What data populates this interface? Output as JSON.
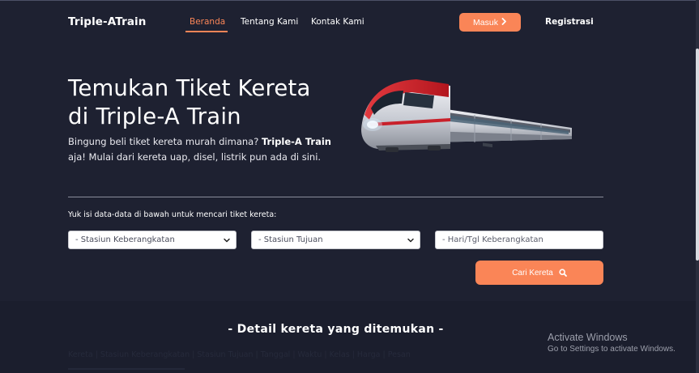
{
  "navbar": {
    "brand": "Triple-ATrain",
    "links": [
      "Beranda",
      "Tentang Kami",
      "Kontak Kami"
    ],
    "login_label": "Masuk",
    "register_label": "Registrasi"
  },
  "hero": {
    "title_line1": "Temukan Tiket Kereta",
    "title_line2": "di Triple-A Train",
    "desc_part1": "Bingung beli tiket kereta murah dimana? ",
    "desc_bold": "Triple-A Train",
    "desc_part2": " aja! Mulai dari kereta uap, disel, listrik pun ada di sini."
  },
  "search": {
    "instruction": "Yuk isi data-data di bawah untuk mencari tiket kereta:",
    "departure_selected": "- Stasiun Keberangkatan",
    "destination_selected": "- Stasiun Tujuan",
    "date_placeholder": "- Hari/Tgl Keberangkatan",
    "submit_label": "Cari Kereta"
  },
  "results": {
    "title": "- Detail kereta yang ditemukan -",
    "faded_header": "Kereta | Stasiun Keberangkatan | Stasiun Tujuan | Tanggal | Waktu | Kelas | Harga | Pesan"
  },
  "watermark": {
    "line1": "Activate Windows",
    "line2": "Go to Settings to activate Windows."
  },
  "colors": {
    "background": "#1e2131",
    "accent": "#fa8557",
    "text": "#ffffff"
  },
  "icons": [
    "chevron-right-icon",
    "chevron-down-icon",
    "search-icon",
    "train-illustration"
  ]
}
